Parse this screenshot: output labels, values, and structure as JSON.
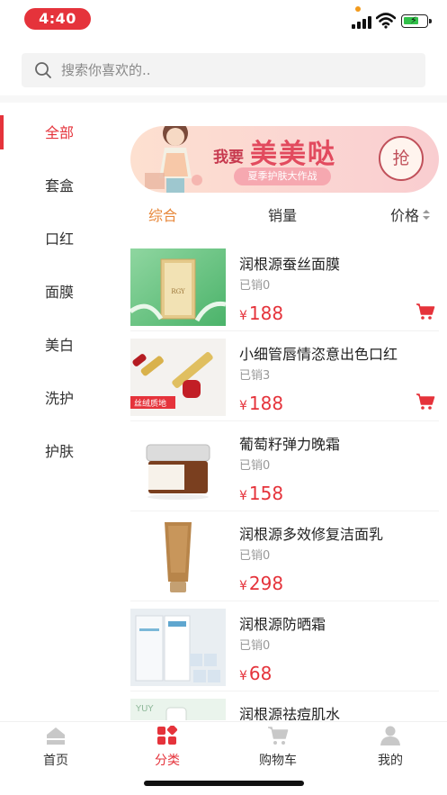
{
  "status_bar": {
    "time": "4:40"
  },
  "search": {
    "placeholder": "搜索你喜欢的.."
  },
  "sidebar": {
    "items": [
      {
        "label": "全部",
        "active": true
      },
      {
        "label": "套盒"
      },
      {
        "label": "口红"
      },
      {
        "label": "面膜"
      },
      {
        "label": "美白"
      },
      {
        "label": "洗护"
      },
      {
        "label": "护肤"
      }
    ]
  },
  "banner": {
    "title_small": "我要",
    "title_large": "美美哒",
    "subtitle": "夏季护肤大作战",
    "grab_label": "抢"
  },
  "sort": {
    "tabs": [
      {
        "label": "综合",
        "active": true
      },
      {
        "label": "销量"
      },
      {
        "label": "价格"
      }
    ]
  },
  "products": [
    {
      "name": "润根源蚕丝面膜",
      "sold": "已销0",
      "currency": "¥",
      "price": "188",
      "cart": true,
      "image": "silk-mask-box"
    },
    {
      "name": "小细管唇情恣意出色口红",
      "sold": "已销3",
      "currency": "¥",
      "price": "188",
      "cart": true,
      "image": "lipstick",
      "image_caption": "丝绒质地"
    },
    {
      "name": "葡萄籽弹力晚霜",
      "sold": "已销0",
      "currency": "¥",
      "price": "158",
      "cart": false,
      "image": "cream-jar"
    },
    {
      "name": "润根源多效修复洁面乳",
      "sold": "已销0",
      "currency": "¥",
      "price": "298",
      "cart": false,
      "image": "cleanser-tube"
    },
    {
      "name": "润根源防晒霜",
      "sold": "已销0",
      "currency": "¥",
      "price": "68",
      "cart": false,
      "image": "sunscreen-box"
    },
    {
      "name": "润根源祛痘肌水",
      "sold": "",
      "currency": "",
      "price": "",
      "cart": false,
      "image": "toner"
    }
  ],
  "tab_bar": {
    "tabs": [
      {
        "label": "首页",
        "icon": "home-icon"
      },
      {
        "label": "分类",
        "icon": "category-icon",
        "active": true
      },
      {
        "label": "购物车",
        "icon": "cart-icon"
      },
      {
        "label": "我的",
        "icon": "profile-icon"
      }
    ]
  },
  "colors": {
    "accent": "#e5333b",
    "sort_active": "#e7873a",
    "muted": "#999999"
  }
}
